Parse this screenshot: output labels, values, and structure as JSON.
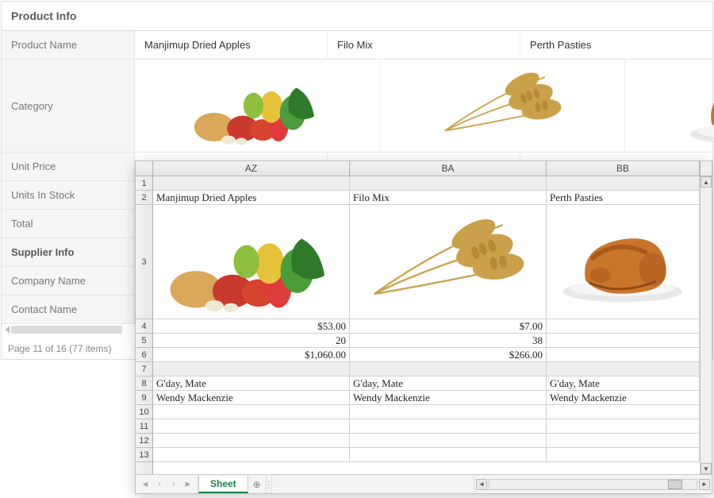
{
  "bg": {
    "title": "Product Info",
    "rows": {
      "product_name": {
        "label": "Product Name",
        "values": [
          "Manjimup Dried Apples",
          "Filo Mix",
          "Perth Pasties"
        ]
      },
      "category": {
        "label": "Category"
      },
      "unit_price": {
        "label": "Unit Price"
      },
      "units_in_stock": {
        "label": "Units In Stock"
      },
      "total": {
        "label": "Total"
      },
      "supplier_info": {
        "label": "Supplier Info"
      },
      "company_name": {
        "label": "Company Name"
      },
      "contact_name": {
        "label": "Contact Name"
      }
    },
    "pager_text": "Page 11 of 16 (77 items)"
  },
  "sheet": {
    "columns": [
      "AZ",
      "BA",
      "BB"
    ],
    "row_numbers": [
      1,
      2,
      3,
      4,
      5,
      6,
      7,
      8,
      9,
      10,
      11,
      12,
      13
    ],
    "tab_name": "Sheet",
    "rows": {
      "r2": [
        "Manjimup Dried Apples",
        "Filo Mix",
        "Perth Pasties"
      ],
      "r4": [
        "$53.00",
        "$7.00",
        ""
      ],
      "r5": [
        "20",
        "38",
        ""
      ],
      "r6": [
        "$1,060.00",
        "$266.00",
        ""
      ],
      "r8": [
        "G'day, Mate",
        "G'day, Mate",
        "G'day, Mate"
      ],
      "r9": [
        "Wendy Mackenzie",
        "Wendy Mackenzie",
        "Wendy Mackenzie"
      ]
    }
  }
}
